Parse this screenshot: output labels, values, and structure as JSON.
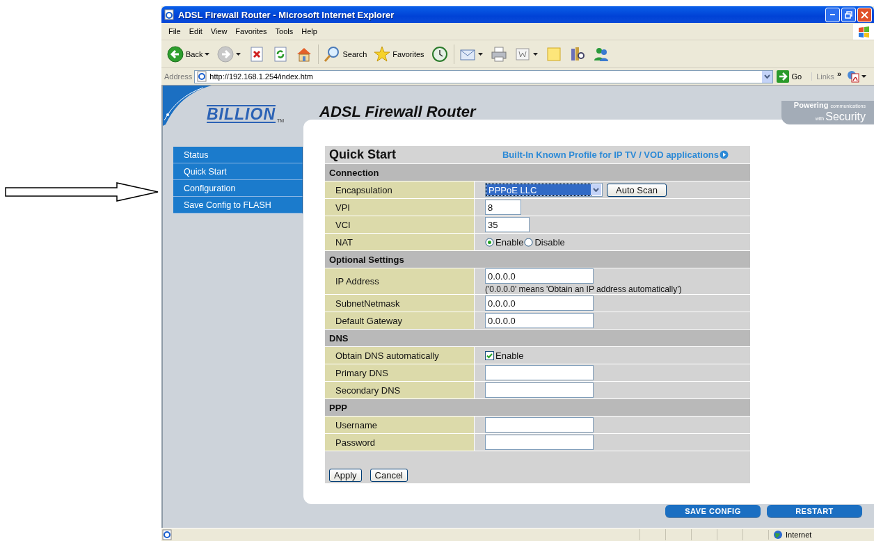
{
  "window": {
    "title": "ADSL Firewall Router - Microsoft Internet Explorer"
  },
  "menu_bar": [
    "File",
    "Edit",
    "View",
    "Favorites",
    "Tools",
    "Help"
  ],
  "toolbar": [
    {
      "kind": "back",
      "label": "Back",
      "caret": true
    },
    {
      "kind": "forward",
      "caret": true
    },
    {
      "kind": "stop"
    },
    {
      "kind": "refresh"
    },
    {
      "kind": "home"
    },
    {
      "kind": "separator"
    },
    {
      "kind": "search",
      "label": "Search"
    },
    {
      "kind": "favorites",
      "label": "Favorites"
    },
    {
      "kind": "history"
    },
    {
      "kind": "separator"
    },
    {
      "kind": "mail",
      "caret": true
    },
    {
      "kind": "print"
    },
    {
      "kind": "edit",
      "caret": true
    },
    {
      "kind": "note"
    },
    {
      "kind": "research"
    },
    {
      "kind": "messenger"
    }
  ],
  "address_bar": {
    "label": "Address",
    "url": "http://192.168.1.254/index.htm",
    "go": "Go",
    "links": "Links",
    "more": "»"
  },
  "brand": {
    "logo": "BILLION",
    "tm": "TM",
    "title": "ADSL Firewall Router",
    "tagline_1": "Powering",
    "tagline_2": "communications",
    "tagline_3": "with",
    "tagline_4": "Security"
  },
  "sidebar": {
    "items": [
      {
        "label": "Status"
      },
      {
        "label": "Quick Start"
      },
      {
        "label": "Configuration"
      },
      {
        "label": "Save Config to FLASH"
      }
    ]
  },
  "form": {
    "title": "Quick Start",
    "profile_link": "Built-In Known Profile for IP TV / VOD applications",
    "sections": [
      {
        "heading": "Connection",
        "rows": [
          {
            "label": "Encapsulation",
            "kind": "select",
            "value": "PPPoE LLC",
            "focused": true,
            "button": "Auto Scan"
          },
          {
            "label": "VPI",
            "kind": "number",
            "value": "8"
          },
          {
            "label": "VCI",
            "kind": "number",
            "value": "35"
          },
          {
            "label": "NAT",
            "kind": "radio",
            "options": [
              {
                "label": "Enable",
                "selected": true
              },
              {
                "label": "Disable",
                "selected": false
              }
            ]
          }
        ]
      },
      {
        "heading": "Optional Settings",
        "rows": [
          {
            "label": "IP Address",
            "kind": "input",
            "value": "0.0.0.0",
            "note": "('0.0.0.0' means 'Obtain an IP address automatically')"
          },
          {
            "label": "SubnetNetmask",
            "kind": "input",
            "value": "0.0.0.0"
          },
          {
            "label": "Default Gateway",
            "kind": "input",
            "value": "0.0.0.0"
          }
        ]
      },
      {
        "heading": "DNS",
        "rows": [
          {
            "label": "Obtain DNS automatically",
            "kind": "checkbox",
            "checked": true,
            "option": "Enable"
          },
          {
            "label": "Primary DNS",
            "kind": "input"
          },
          {
            "label": "Secondary DNS",
            "kind": "input"
          }
        ]
      },
      {
        "heading": "PPP",
        "rows": [
          {
            "label": "Username",
            "kind": "input"
          },
          {
            "label": "Password",
            "kind": "password"
          }
        ]
      }
    ],
    "buttons": [
      "Apply",
      "Cancel"
    ]
  },
  "footer_buttons": [
    "SAVE CONFIG",
    "RESTART"
  ],
  "status_bar": {
    "zone": "Internet"
  }
}
